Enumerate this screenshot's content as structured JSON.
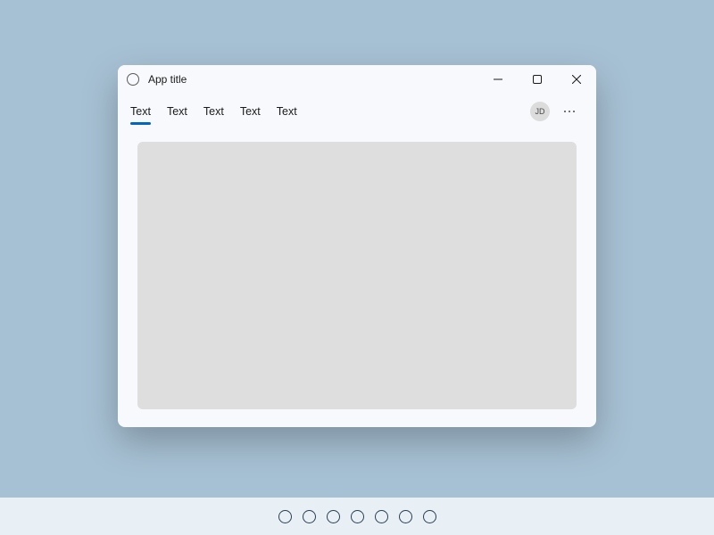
{
  "window": {
    "title": "App title"
  },
  "tabs": [
    {
      "label": "Text",
      "active": true
    },
    {
      "label": "Text",
      "active": false
    },
    {
      "label": "Text",
      "active": false
    },
    {
      "label": "Text",
      "active": false
    },
    {
      "label": "Text",
      "active": false
    }
  ],
  "user": {
    "initials": "JD"
  },
  "taskbar": {
    "item_count": 7
  }
}
